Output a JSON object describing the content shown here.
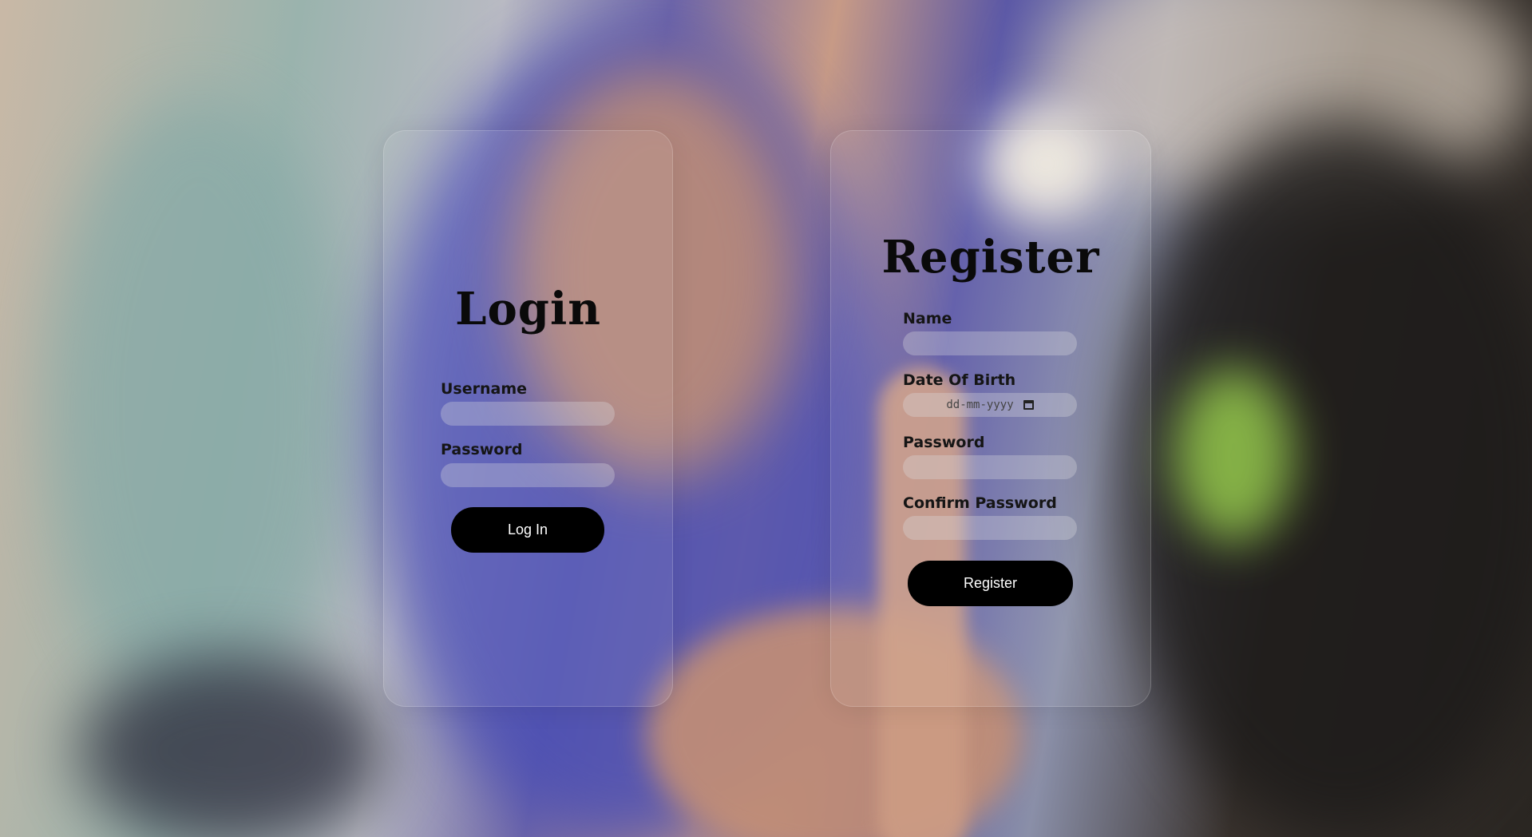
{
  "login": {
    "title": "Login",
    "username_label": "Username",
    "password_label": "Password",
    "button_label": "Log In"
  },
  "register": {
    "title": "Register",
    "name_label": "Name",
    "dob_label": "Date Of Birth",
    "dob_placeholder": "dd-mm-yyyy",
    "password_label": "Password",
    "confirm_password_label": "Confirm Password",
    "button_label": "Register"
  }
}
